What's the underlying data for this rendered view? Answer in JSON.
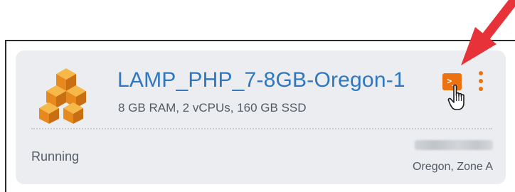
{
  "instance": {
    "name": "LAMP_PHP_7-8GB-Oregon-1",
    "specs": "8 GB RAM, 2 vCPUs, 160 GB SSD",
    "status": "Running",
    "location": "Oregon, Zone A",
    "icon": "stacked-cubes-icon"
  },
  "actions": {
    "terminal_glyph": ">_",
    "terminal_icon": "terminal-icon",
    "menu_icon": "kebab-menu-icon"
  },
  "overlay": {
    "arrow_icon": "red-arrow-icon",
    "cursor_icon": "hand-pointer-cursor-icon"
  },
  "colors": {
    "accent": "#ec7211",
    "link": "#2f77bf",
    "card_bg": "#ebedf0",
    "arrow": "#e8323a"
  }
}
